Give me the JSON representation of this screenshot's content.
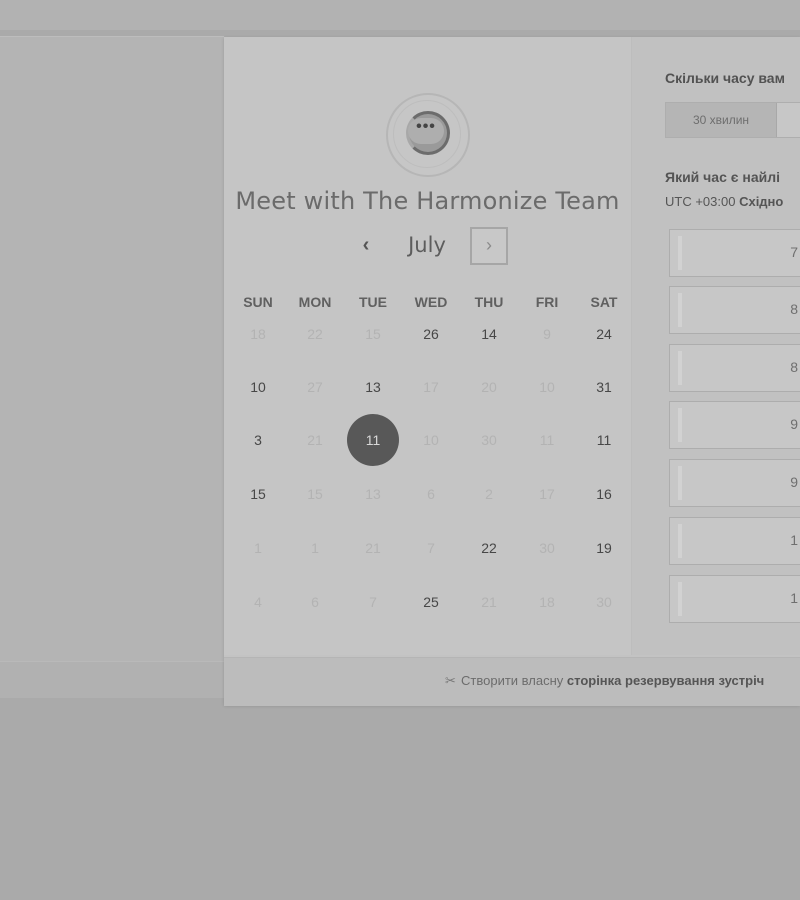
{
  "calendar": {
    "title": "Meet with The Harmonize Team",
    "month": "July",
    "prev_symbol": "‹",
    "next_symbol": "›",
    "avatar_dots": "•••",
    "weekdays": [
      "SUN",
      "MON",
      "TUE",
      "WED",
      "THU",
      "FRI",
      "SAT"
    ],
    "rows": [
      [
        {
          "t": "18",
          "s": "off"
        },
        {
          "t": "22",
          "s": "off"
        },
        {
          "t": "15",
          "s": "off"
        },
        {
          "t": "26",
          "s": "on"
        },
        {
          "t": "14",
          "s": "on"
        },
        {
          "t": "9",
          "s": "off"
        },
        {
          "t": "24",
          "s": "on"
        }
      ],
      [
        {
          "t": "10",
          "s": "on"
        },
        {
          "t": "27",
          "s": "off"
        },
        {
          "t": "13",
          "s": "on"
        },
        {
          "t": "17",
          "s": "off"
        },
        {
          "t": "20",
          "s": "off"
        },
        {
          "t": "10",
          "s": "off"
        },
        {
          "t": "31",
          "s": "on"
        }
      ],
      [
        {
          "t": "3",
          "s": "on"
        },
        {
          "t": "21",
          "s": "off"
        },
        {
          "t": "11",
          "s": "sel"
        },
        {
          "t": "10",
          "s": "off"
        },
        {
          "t": "30",
          "s": "off"
        },
        {
          "t": "11",
          "s": "off"
        },
        {
          "t": "11",
          "s": "on"
        }
      ],
      [
        {
          "t": "15",
          "s": "on"
        },
        {
          "t": "15",
          "s": "off"
        },
        {
          "t": "13",
          "s": "off"
        },
        {
          "t": "6",
          "s": "off"
        },
        {
          "t": "2",
          "s": "off"
        },
        {
          "t": "17",
          "s": "off"
        },
        {
          "t": "16",
          "s": "on"
        }
      ],
      [
        {
          "t": "1",
          "s": "off"
        },
        {
          "t": "1",
          "s": "off"
        },
        {
          "t": "21",
          "s": "off"
        },
        {
          "t": "7",
          "s": "off"
        },
        {
          "t": "22",
          "s": "on"
        },
        {
          "t": "30",
          "s": "off"
        },
        {
          "t": "19",
          "s": "on"
        }
      ],
      [
        {
          "t": "4",
          "s": "off"
        },
        {
          "t": "6",
          "s": "off"
        },
        {
          "t": "7",
          "s": "off"
        },
        {
          "t": "25",
          "s": "on"
        },
        {
          "t": "21",
          "s": "off"
        },
        {
          "t": "18",
          "s": "off"
        },
        {
          "t": "30",
          "s": "off"
        }
      ]
    ]
  },
  "duration": {
    "question": "Скільки часу вам",
    "options": [
      "30 хвилин"
    ]
  },
  "times": {
    "question": "Який час є найлі",
    "timezone_offset": "UTC +03:00",
    "timezone_name": "Східно",
    "slots": [
      "7",
      "8",
      "8",
      "9",
      "9",
      "1",
      "1"
    ]
  },
  "footer": {
    "icon": "scissors-icon",
    "icon_glyph": "✂",
    "text_plain": "Створити власну",
    "text_bold": "сторінка резервування зустріч"
  }
}
